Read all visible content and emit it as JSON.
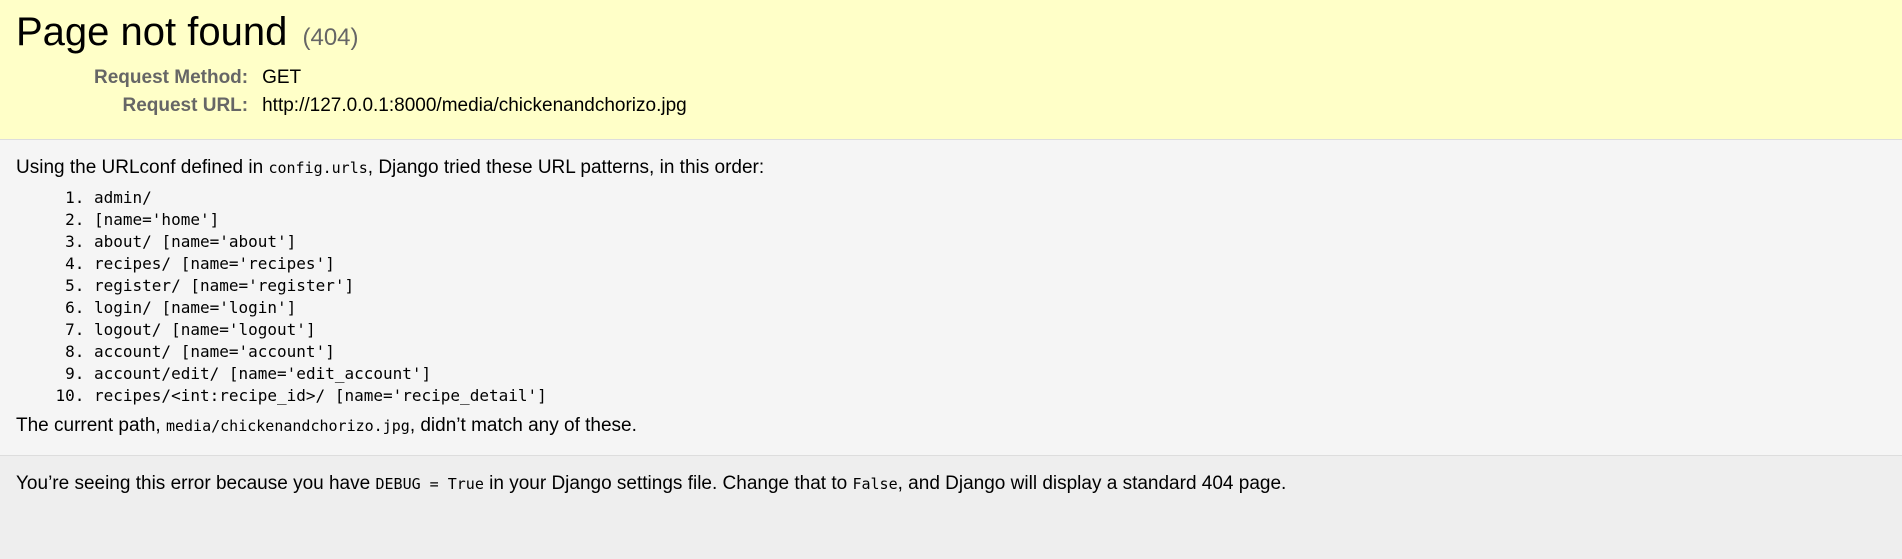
{
  "summary": {
    "title": "Page not found",
    "code": "(404)",
    "request_method_label": "Request Method:",
    "request_method": "GET",
    "request_url_label": "Request URL:",
    "request_url": "http://127.0.0.1:8000/media/chickenandchorizo.jpg"
  },
  "info": {
    "intro_before": "Using the URLconf defined in ",
    "urlconf": "config.urls",
    "intro_after": ", Django tried these URL patterns, in this order:",
    "patterns": [
      {
        "num": "1.",
        "path": "admin/",
        "name": ""
      },
      {
        "num": "2.",
        "path": "",
        "name": "[name='home']"
      },
      {
        "num": "3.",
        "path": "about/",
        "name": "[name='about']"
      },
      {
        "num": "4.",
        "path": "recipes/",
        "name": "[name='recipes']"
      },
      {
        "num": "5.",
        "path": "register/",
        "name": "[name='register']"
      },
      {
        "num": "6.",
        "path": "login/",
        "name": "[name='login']"
      },
      {
        "num": "7.",
        "path": "logout/",
        "name": "[name='logout']"
      },
      {
        "num": "8.",
        "path": "account/",
        "name": "[name='account']"
      },
      {
        "num": "9.",
        "path": "account/edit/",
        "name": "[name='edit_account']"
      },
      {
        "num": "10.",
        "path": "recipes/<int:recipe_id>/",
        "name": "[name='recipe_detail']"
      }
    ],
    "current_before": "The current path, ",
    "current_path": "media/chickenandchorizo.jpg",
    "current_after": ", didn’t match any of these."
  },
  "explanation": {
    "text_1": "You’re seeing this error because you have ",
    "code_1": "DEBUG = True",
    "text_2": " in your Django settings file. Change that to ",
    "code_2": "False",
    "text_3": ", and Django will display a standard 404 page."
  }
}
